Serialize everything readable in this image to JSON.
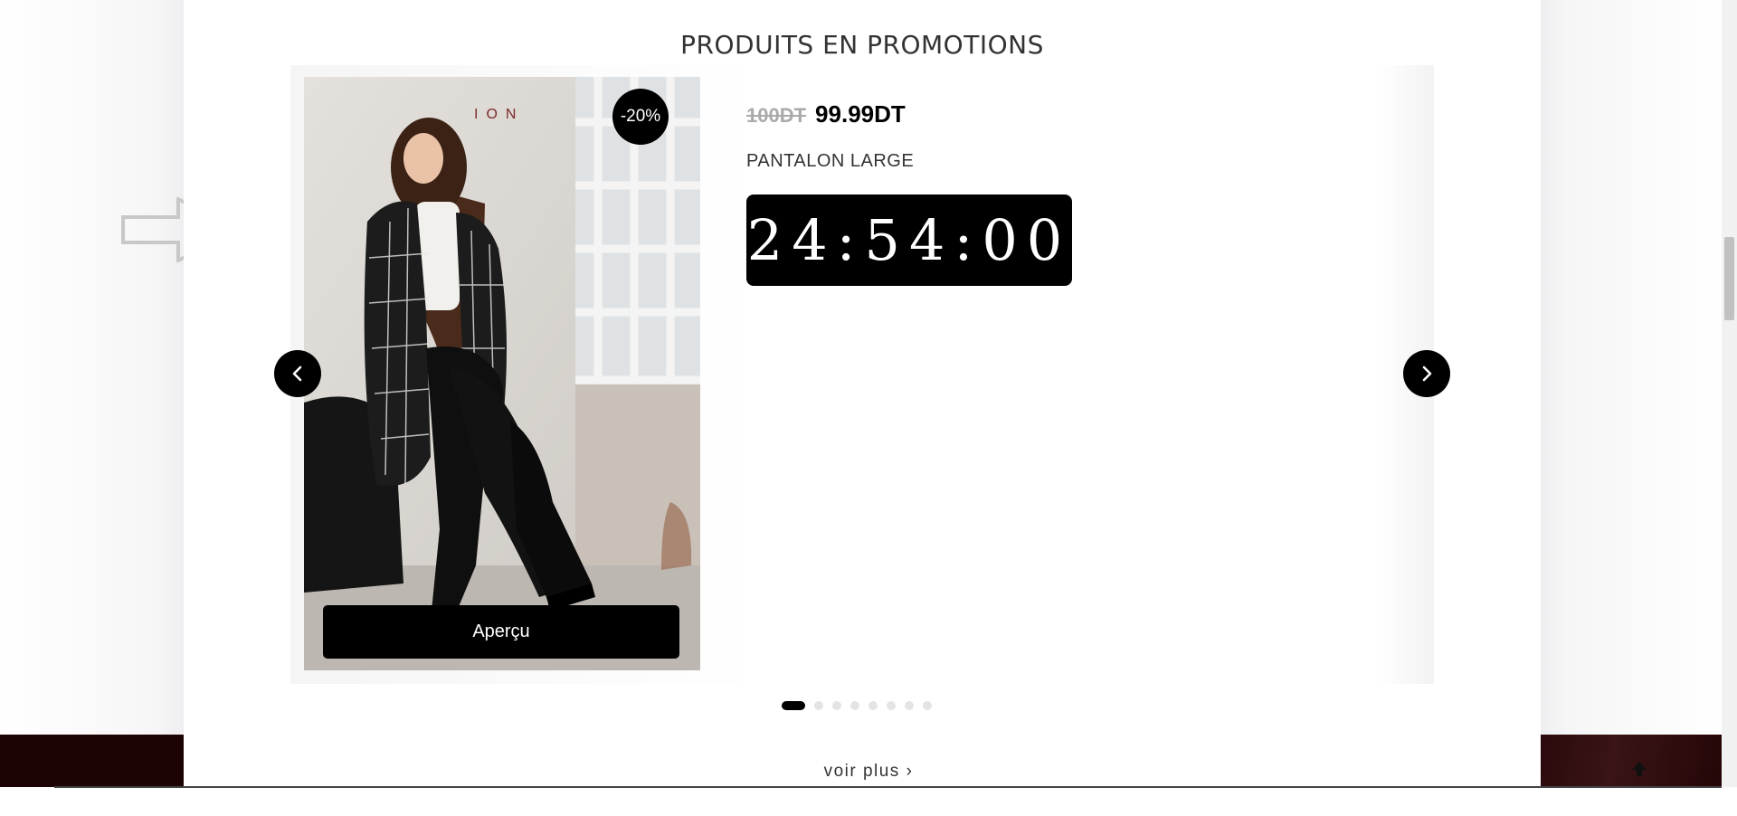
{
  "section": {
    "title": "PRODUITS EN PROMOTIONS"
  },
  "product": {
    "brand_mark": "ION",
    "discount": "-20%",
    "old_price": "100DT",
    "new_price": "99.99DT",
    "name": "PANTALON LARGE",
    "countdown": "24:54:00",
    "preview_label": "Aperçu"
  },
  "carousel": {
    "prev_icon": "chevron-left-icon",
    "next_icon": "chevron-right-icon",
    "dots": [
      {
        "active": true
      },
      {
        "active": false
      },
      {
        "active": false
      },
      {
        "active": false
      },
      {
        "active": false
      },
      {
        "active": false
      },
      {
        "active": false
      },
      {
        "active": false
      }
    ]
  },
  "footer_link": {
    "label": "voir plus ›"
  },
  "colors": {
    "accent": "#000000",
    "dark_band": "#1e0305"
  }
}
